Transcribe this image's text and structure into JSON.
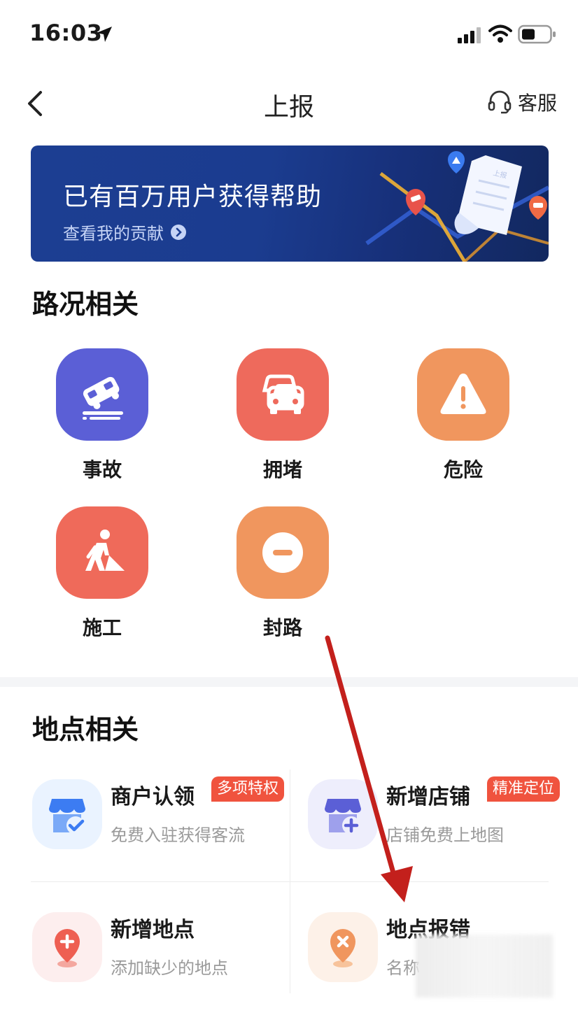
{
  "status_bar": {
    "time": "16:03"
  },
  "nav": {
    "title": "上报",
    "service_label": "客服"
  },
  "banner": {
    "title": "已有百万用户获得帮助",
    "link": "查看我的贡献",
    "slip_text": "上报"
  },
  "road_section": {
    "title": "路况相关",
    "items": [
      {
        "label": "事故",
        "icon": "accident-icon",
        "color": "#5b5fd6"
      },
      {
        "label": "拥堵",
        "icon": "congestion-icon",
        "color": "#ee6a5c"
      },
      {
        "label": "危险",
        "icon": "danger-icon",
        "color": "#f0965e"
      },
      {
        "label": "施工",
        "icon": "construction-icon",
        "color": "#ef6a5a"
      },
      {
        "label": "封路",
        "icon": "road-closed-icon",
        "color": "#f0965e"
      }
    ]
  },
  "place_section": {
    "title": "地点相关",
    "items": [
      {
        "title": "商户认领",
        "subtitle": "免费入驻获得客流",
        "badge": "多项特权",
        "icon": "store-claim-icon"
      },
      {
        "title": "新增店铺",
        "subtitle": "店铺免费上地图",
        "badge": "精准定位",
        "icon": "store-add-icon"
      },
      {
        "title": "新增地点",
        "subtitle": "添加缺少的地点",
        "icon": "place-add-icon"
      },
      {
        "title": "地点报错",
        "subtitle": "名称",
        "icon": "place-error-icon"
      }
    ]
  },
  "colors": {
    "badge": "#f0533e",
    "banner": "#1c3e92",
    "annotation_arrow": "#c3201c"
  }
}
